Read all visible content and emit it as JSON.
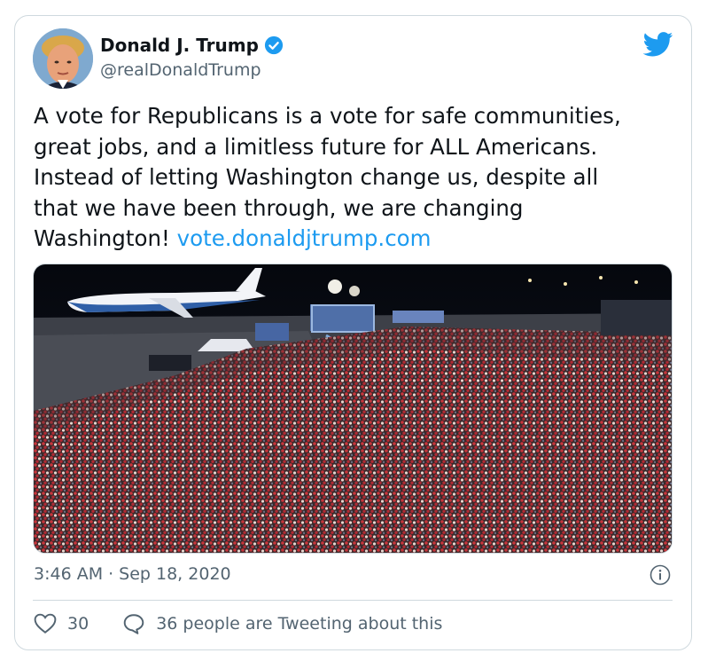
{
  "author": {
    "name": "Donald J. Trump",
    "handle": "@realDonaldTrump",
    "verified_icon": "verified-badge-icon",
    "avatar": "avatar"
  },
  "tweet": {
    "text_lines": [
      "A vote for Republicans is a vote for safe communities,",
      "great jobs, and a limitless future for ALL Americans.",
      "Instead of letting Washington change us, despite all",
      "that we have been through, we are changing"
    ],
    "last_line_text": "Washington!",
    "link": "vote.donaldjtrump.com",
    "image": "rally-photo"
  },
  "meta": {
    "time": "3:46 AM",
    "separator": "·",
    "date": "Sep 18, 2020"
  },
  "actions": {
    "likes": "30",
    "conversation": "36 people are Tweeting about this"
  },
  "colors": {
    "link": "#1d9bf0",
    "muted": "#536471",
    "border": "#cfd9de"
  }
}
